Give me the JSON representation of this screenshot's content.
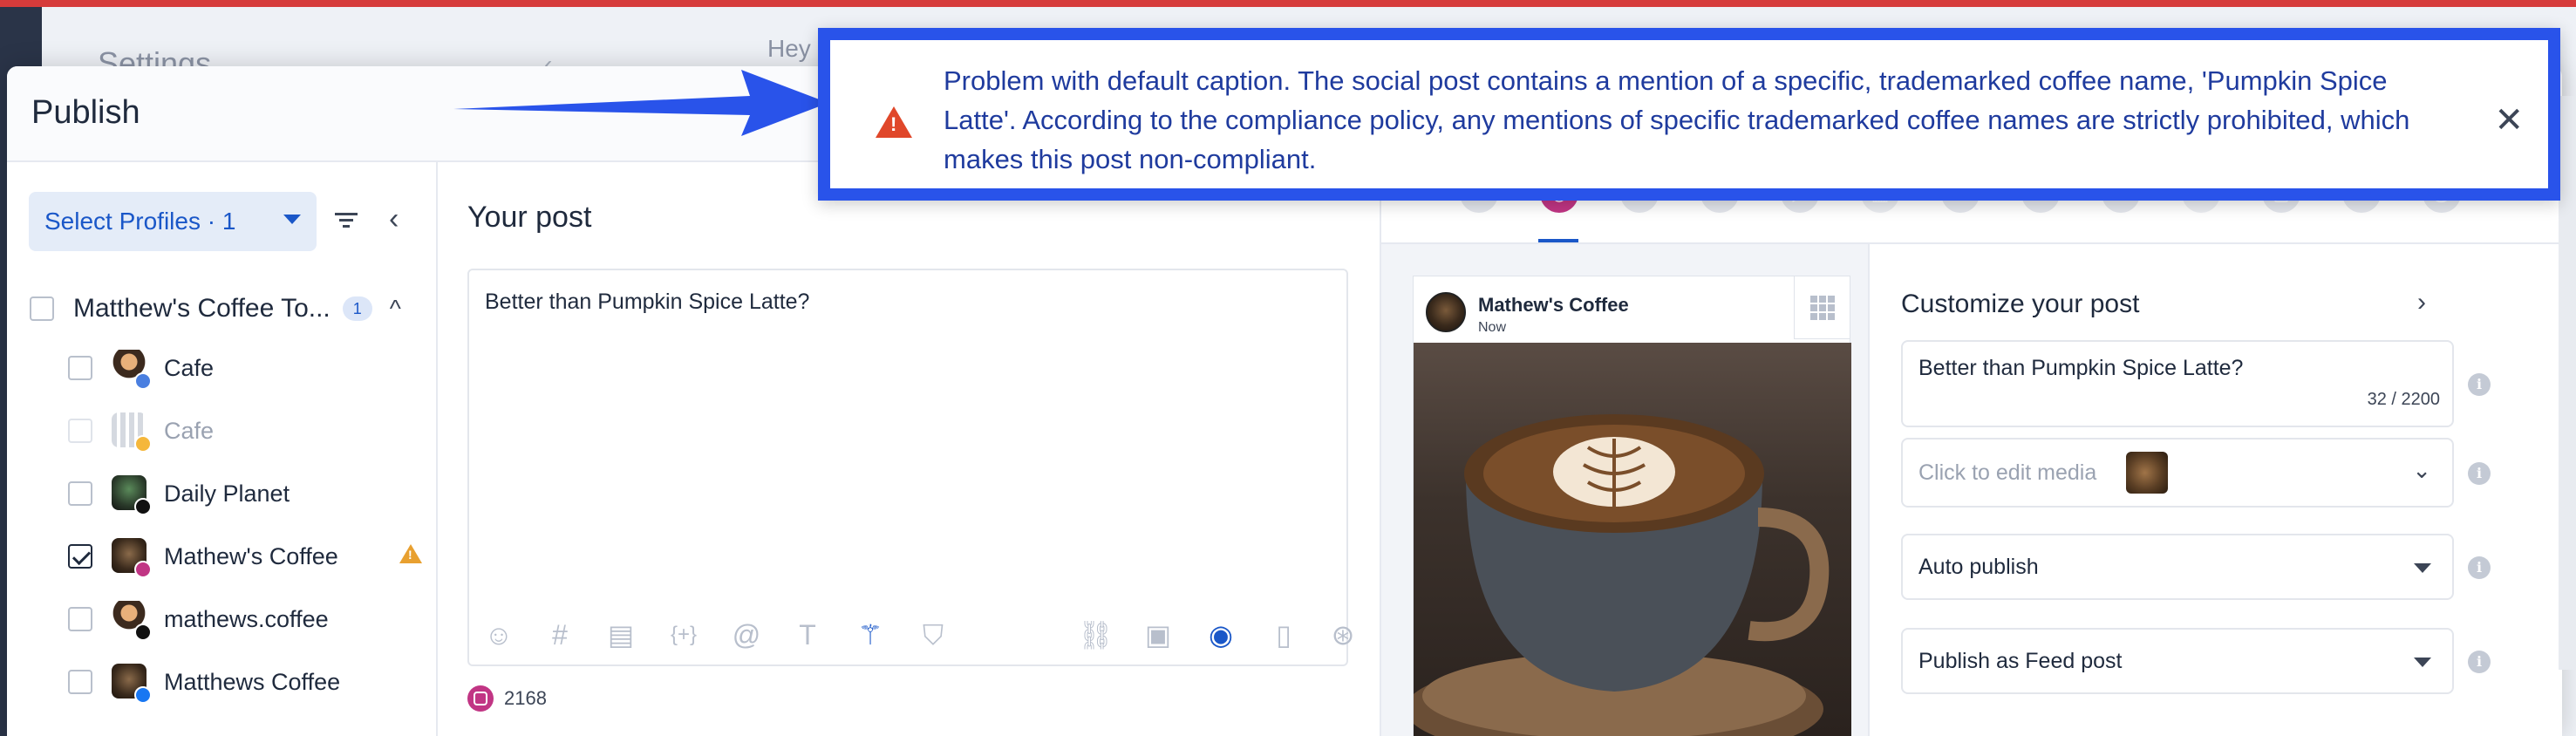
{
  "background": {
    "settings_label": "Settings",
    "greeting": "Hey"
  },
  "modal": {
    "title": "Publish"
  },
  "profiles": {
    "select_label": "Select Profiles · 1",
    "group": {
      "name": "Matthew's Coffee To...",
      "count": "1"
    },
    "items": [
      {
        "label": "Cafe",
        "checked": false,
        "muted": false,
        "network": "google-business"
      },
      {
        "label": "Cafe",
        "checked": false,
        "muted": true,
        "network": "location"
      },
      {
        "label": "Daily Planet",
        "checked": false,
        "muted": false,
        "network": "x"
      },
      {
        "label": "Mathew's Coffee",
        "checked": true,
        "muted": false,
        "network": "instagram",
        "warning": true
      },
      {
        "label": "mathews.coffee",
        "checked": false,
        "muted": false,
        "network": "threads"
      },
      {
        "label": "Matthews Coffee",
        "checked": false,
        "muted": false,
        "network": "facebook"
      }
    ]
  },
  "editor": {
    "heading": "Your post",
    "text": "Better than Pumpkin Spice Latte?",
    "remaining": "2168"
  },
  "social_networks": [
    "facebook",
    "instagram",
    "linkedin",
    "x",
    "youtube",
    "google-business",
    "reddit",
    "pinterest",
    "tiktok",
    "snapchat",
    "bluesky",
    "tumblr",
    "threads"
  ],
  "preview": {
    "account_name": "Mathew's Coffee",
    "time": "Now"
  },
  "customize": {
    "title": "Customize your post",
    "caption": "Better than Pumpkin Spice Latte?",
    "char_count": "32 / 2200",
    "media_placeholder": "Click to edit media",
    "publish_mode": "Auto publish",
    "post_type": "Publish as Feed post"
  },
  "notice": {
    "text": "Problem with default caption. The social post contains a mention of a specific, trademarked coffee name, 'Pumpkin Spice Latte'. According to the compliance policy, any mentions of specific trademarked coffee names are strictly prohibited, which makes this post non-compliant.",
    "icon": "warning-icon",
    "border_color": "#2953ea"
  }
}
